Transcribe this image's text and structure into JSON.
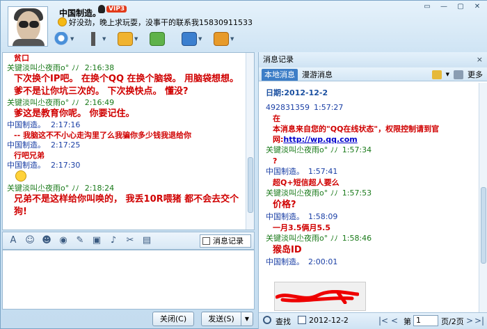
{
  "window": {
    "name": "中国制造。",
    "vip": "VIP3",
    "signature": "好没劲，晚上求玩耍，没事干的联系我15830911533",
    "controls": [
      "▭",
      "—",
      "▢",
      "✕"
    ]
  },
  "toolbar_icons": [
    "video-call-icon",
    "voice-call-icon",
    "file-transfer-icon",
    "message-icon",
    "remote-desktop-icon",
    "app-box-icon"
  ],
  "chat": {
    "messages": [
      {
        "kind": "text",
        "text": "贫口",
        "size": "small"
      },
      {
        "kind": "meta",
        "sender": "关键淡叫尐夜雨o°",
        "mark": "ﾉﾉ",
        "time": "2:16:38",
        "self": false
      },
      {
        "kind": "text",
        "text": "下次换个IP吧。 在换个QQ 在换个脑袋。 用脑袋想想。 爹不是让你坑三次的。 下次换快点。 懂没?"
      },
      {
        "kind": "meta",
        "sender": "关键淡叫尐夜雨o°",
        "mark": "ﾉﾉ",
        "time": "2:16:49",
        "self": false
      },
      {
        "kind": "text",
        "text": "爹这是教育你呢。 你要记住。"
      },
      {
        "kind": "meta",
        "sender": "中国制造。",
        "mark": "",
        "time": "2:17:16",
        "self": true
      },
      {
        "kind": "text",
        "text": "-- 我脑这不不小心走沟里了么我骗你多少钱我退给你",
        "size": "small"
      },
      {
        "kind": "meta",
        "sender": "中国制造。",
        "mark": "",
        "time": "2:17:25",
        "self": true
      },
      {
        "kind": "text",
        "text": "行吧兄弟",
        "size": "small"
      },
      {
        "kind": "meta",
        "sender": "中国制造。",
        "mark": "",
        "time": "2:17:30",
        "self": true
      },
      {
        "kind": "emoji"
      },
      {
        "kind": "meta",
        "sender": "关键淡叫尐夜雨o°",
        "mark": "ﾉﾉ",
        "time": "2:18:24",
        "self": false
      },
      {
        "kind": "text",
        "text": "兄弟不是这样给你叫唤的， 我丢10R喂猪 都不会去交个狗!"
      }
    ]
  },
  "format_toolbar": {
    "icons": [
      "A",
      "☺",
      "☻",
      "◉",
      "✎",
      "▣",
      "♪",
      "✂",
      "▤"
    ],
    "history_label": "消息记录"
  },
  "buttons": {
    "close": "关闭(C)",
    "send": "发送(S)",
    "send_dropdown": "▼"
  },
  "history": {
    "title": "消息记录",
    "close": "×",
    "tab_local": "本地消息",
    "tab_roam": "漫游消息",
    "more": "更多",
    "date": "日期:2012-12-2",
    "entries": [
      {
        "kind": "meta",
        "sender": "492831359",
        "time": "1:57:27",
        "green": false
      },
      {
        "kind": "text",
        "text": "在"
      },
      {
        "kind": "text",
        "text": "本消息来自您的\"QQ在线状态\"，权限控制请到官网:",
        "link": "http://wp.qq.com"
      },
      {
        "kind": "meta",
        "sender": "关键淡叫尐夜雨o°",
        "mark": "ﾉﾉ",
        "time": "1:57:34",
        "green": true
      },
      {
        "kind": "text",
        "text": "?"
      },
      {
        "kind": "meta",
        "sender": "中国制造。",
        "time": "1:57:41",
        "green": false
      },
      {
        "kind": "text",
        "text": "超Q+短信超人要么"
      },
      {
        "kind": "meta",
        "sender": "关键淡叫尐夜雨o°",
        "mark": "ﾉﾉ",
        "time": "1:57:53",
        "green": true
      },
      {
        "kind": "text",
        "text": "价格?",
        "big": true
      },
      {
        "kind": "meta",
        "sender": "中国制造。",
        "time": "1:58:09",
        "green": false
      },
      {
        "kind": "text",
        "text": "一月3.5俩月5.5"
      },
      {
        "kind": "meta",
        "sender": "关键淡叫尐夜雨o°",
        "mark": "ﾉﾉ",
        "time": "1:58:46",
        "green": true
      },
      {
        "kind": "text",
        "text": "猴岛ID",
        "big": true
      },
      {
        "kind": "meta",
        "sender": "中国制造。",
        "time": "2:00:01",
        "green": false
      }
    ],
    "footer": {
      "find": "查找",
      "date": "2012-12-2",
      "first": "|<",
      "prev": "<",
      "page_prefix": "第",
      "page_value": "1",
      "page_suffix": "页/2页",
      "next": ">",
      "last": ">|"
    }
  },
  "colors": {
    "accent": "#3d7ec7",
    "message_red": "#d00000",
    "sender_green": "#1a7a1a",
    "sender_blue": "#1a3fa5"
  }
}
